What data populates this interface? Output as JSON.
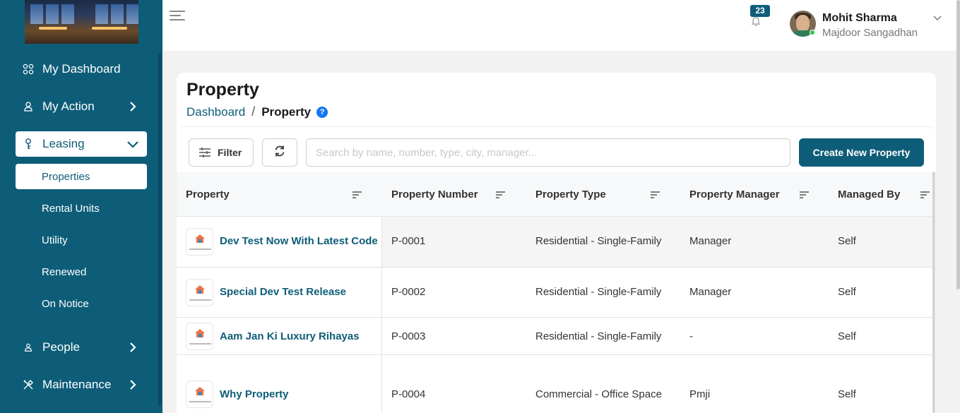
{
  "sidebar": {
    "items": [
      {
        "label": "My Dashboard",
        "icon": "grid-icon"
      },
      {
        "label": "My Action",
        "icon": "user-icon"
      },
      {
        "label": "Leasing",
        "icon": "key-icon"
      },
      {
        "label": "People",
        "icon": "people-icon"
      },
      {
        "label": "Maintenance",
        "icon": "tools-icon"
      }
    ],
    "leasing_sub": [
      "Properties",
      "Rental Units",
      "Utility",
      "Renewed",
      "On Notice"
    ]
  },
  "header": {
    "notification_count": "23",
    "user_name": "Mohit Sharma",
    "user_org": "Majdoor Sangadhan"
  },
  "page": {
    "title": "Property",
    "breadcrumb": {
      "root": "Dashboard",
      "separator": "/",
      "current": "Property"
    },
    "help": "?"
  },
  "toolbar": {
    "filter_label": "Filter",
    "search_placeholder": "Search by name, number, type, city, manager...",
    "create_label": "Create New Property"
  },
  "table": {
    "columns": [
      "Property",
      "Property Number",
      "Property Type",
      "Property Manager",
      "Managed By"
    ],
    "rows": [
      {
        "name": "Dev Test Now With Latest Code",
        "number": "P-0001",
        "type": "Residential - Single-Family",
        "manager": "Manager",
        "managed_by": "Self"
      },
      {
        "name": "Special Dev Test Release",
        "number": "P-0002",
        "type": "Residential - Single-Family",
        "manager": "Manager",
        "managed_by": "Self"
      },
      {
        "name": "Aam Jan Ki Luxury Rihayas",
        "number": "P-0003",
        "type": "Residential - Single-Family",
        "manager": "-",
        "managed_by": "Self"
      },
      {
        "name": "Why Property",
        "number": "P-0004",
        "type": "Commercial - Office Space",
        "manager": "Pmji",
        "managed_by": "Self"
      }
    ]
  },
  "colors": {
    "brand": "#0e5d78",
    "help_blue": "#1877f2",
    "online": "#2ecc40"
  }
}
